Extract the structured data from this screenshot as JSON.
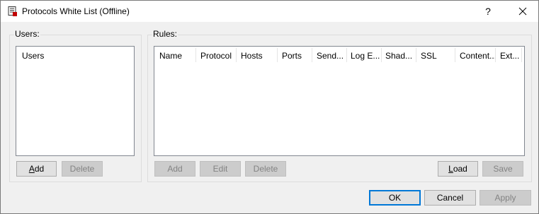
{
  "window": {
    "title": "Protocols White List (Offline)",
    "help_glyph": "?"
  },
  "users": {
    "group_label": "Users:",
    "list_header": "Users",
    "add": {
      "pre": "",
      "key": "A",
      "post": "dd"
    },
    "delete": {
      "pre": "",
      "key": "",
      "post": "Delete"
    }
  },
  "rules": {
    "group_label": "Rules:",
    "columns": [
      "Name",
      "Protocol",
      "Hosts",
      "Ports",
      "Send...",
      "Log E...",
      "Shad...",
      "SSL",
      "Content...",
      "Ext..."
    ],
    "add": {
      "pre": "",
      "key": "",
      "post": "Add"
    },
    "edit": {
      "pre": "",
      "key": "",
      "post": "Edit"
    },
    "delete": {
      "pre": "",
      "key": "",
      "post": "Delete"
    },
    "load": {
      "pre": "",
      "key": "L",
      "post": "oad"
    },
    "save": {
      "pre": "",
      "key": "",
      "post": "Save"
    }
  },
  "footer": {
    "ok": "OK",
    "cancel": "Cancel",
    "apply": "Apply"
  },
  "colors": {
    "default_button_border": "#0078d7",
    "disabled_text": "#838383",
    "window_bg": "#f0f0f0"
  }
}
